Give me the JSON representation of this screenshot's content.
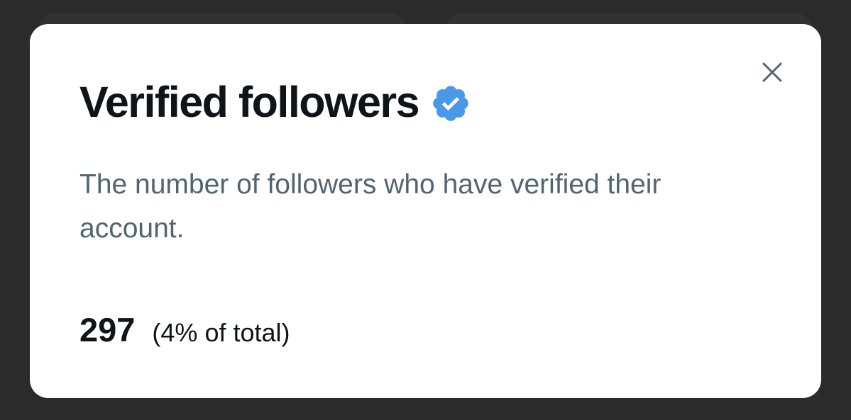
{
  "modal": {
    "title": "Verified followers",
    "description": "The number of followers who have verified their account.",
    "stat_value": "297",
    "stat_percent": "(4% of total)",
    "close_icon": "close-icon",
    "badge_icon": "verified-badge-icon"
  },
  "colors": {
    "badge": "#4a99e9",
    "title": "#0f1419",
    "description": "#536471",
    "backdrop": "#2b2b2c",
    "close_icon": "#536471"
  }
}
